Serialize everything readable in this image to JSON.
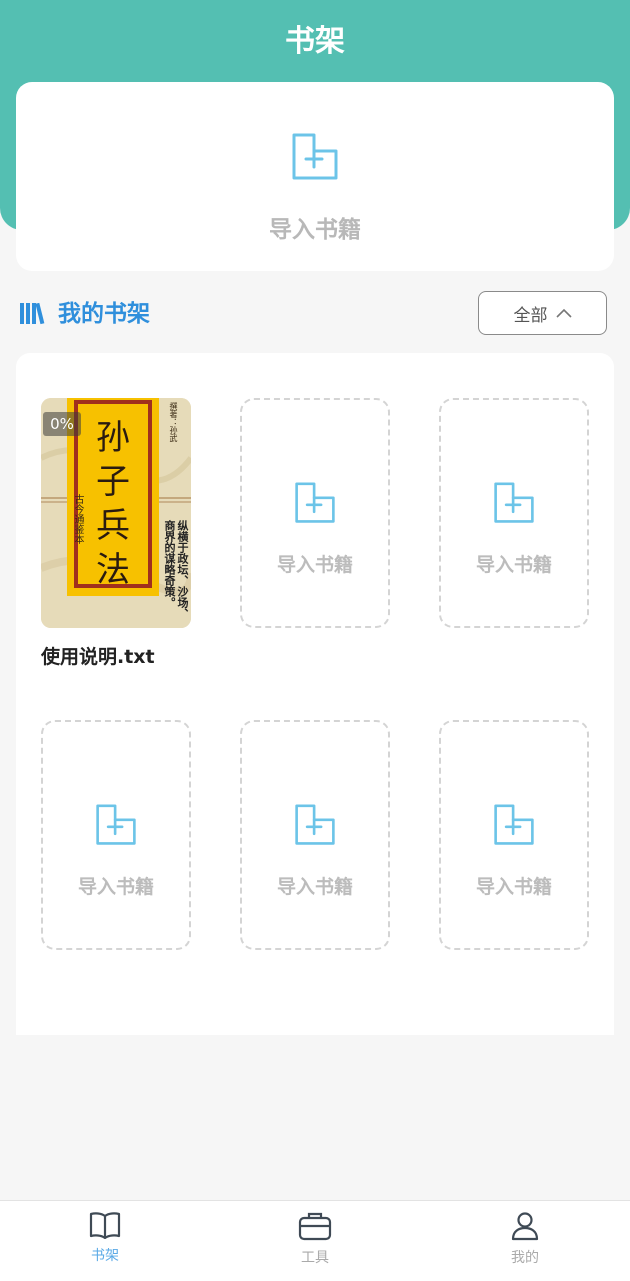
{
  "header": {
    "title": "书架"
  },
  "import_card": {
    "label": "导入书籍"
  },
  "section": {
    "title": "我的书架",
    "filter_label": "全部"
  },
  "books": [
    {
      "file_name": "使用说明.txt",
      "progress": "0%",
      "cover": {
        "title_chars": [
          "孙",
          "子",
          "兵",
          "法"
        ],
        "side_text": "古今通鉴本",
        "author_text": "撰著：孙武",
        "blurb": "纵横于政坛、沙场、商界的谋略奇策。"
      }
    }
  ],
  "empty_slot_label": "导入书籍",
  "tabbar": {
    "items": [
      {
        "label": "书架",
        "icon": "book-open-icon",
        "active": true
      },
      {
        "label": "工具",
        "icon": "briefcase-icon",
        "active": false
      },
      {
        "label": "我的",
        "icon": "user-icon",
        "active": false
      }
    ]
  },
  "colors": {
    "primary": "#54bfb2",
    "accent_blue": "#2f8fdc",
    "icon_blue": "#6cc4e8",
    "muted": "#b8b8b8"
  }
}
